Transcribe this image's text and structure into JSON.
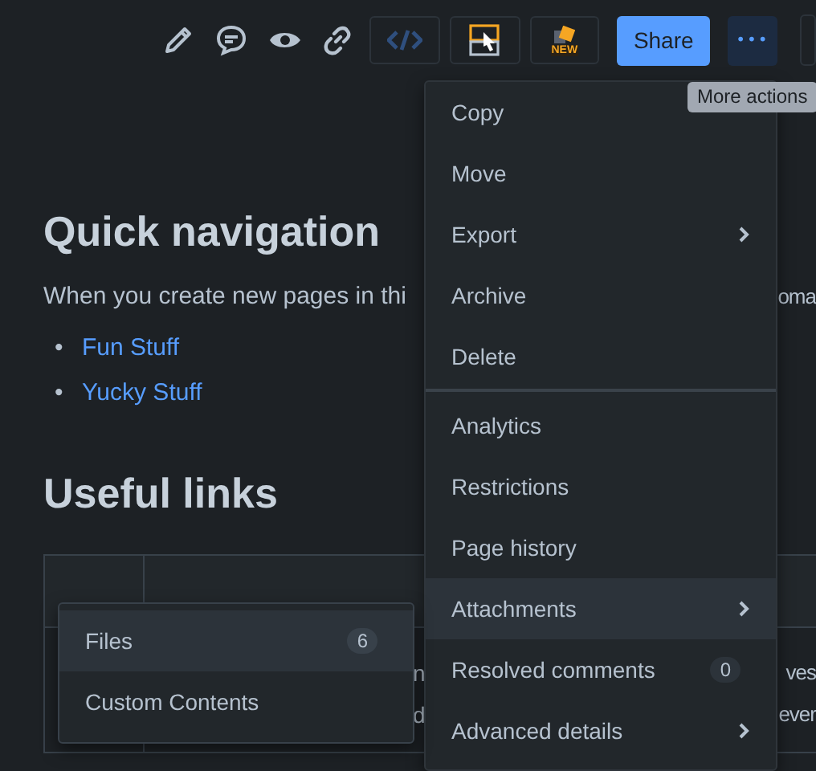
{
  "toolbar": {
    "icons": [
      {
        "kind": "edit"
      },
      {
        "kind": "comment"
      },
      {
        "kind": "watch"
      },
      {
        "kind": "link"
      }
    ],
    "tools": [
      {
        "kind": "code"
      },
      {
        "kind": "macro"
      },
      {
        "kind": "new",
        "label": "NEW"
      }
    ],
    "share": "Share",
    "more": {
      "label": "•••",
      "selected": true
    }
  },
  "tooltip": "More actions",
  "content": {
    "heading_1": "Quick navigation",
    "paragraph": {
      "left": "When you create new pages in thi",
      "right": "oma"
    },
    "links": [
      {
        "marker": "•",
        "label": "Fun Stuff"
      },
      {
        "marker": "•",
        "label": "Yucky Stuff"
      }
    ],
    "heading_2": "Useful links",
    "table": {
      "lines": [
        {
          "left": "n",
          "right": "ves"
        },
        {
          "left": "d",
          "right": "ever"
        }
      ]
    }
  },
  "menu": {
    "sections": [
      {
        "items": [
          {
            "label": "Copy",
            "selected": false,
            "submenu": false
          },
          {
            "label": "Move",
            "selected": false,
            "submenu": false
          },
          {
            "label": "Export",
            "selected": false,
            "submenu": true
          },
          {
            "label": "Archive",
            "selected": false,
            "submenu": false
          },
          {
            "label": "Delete",
            "selected": false,
            "submenu": false
          }
        ]
      },
      {
        "items": [
          {
            "label": "Analytics",
            "selected": false,
            "submenu": false
          },
          {
            "label": "Restrictions",
            "selected": false,
            "submenu": false
          },
          {
            "label": "Page history",
            "selected": false,
            "submenu": false
          },
          {
            "label": "Attachments",
            "selected": true,
            "submenu": true
          },
          {
            "label": "Resolved comments",
            "selected": false,
            "submenu": false,
            "badge": "0"
          },
          {
            "label": "Advanced details",
            "selected": false,
            "submenu": true
          }
        ]
      }
    ]
  },
  "submenu": {
    "items": [
      {
        "label": "Files",
        "selected": true,
        "badge": "6"
      },
      {
        "label": "Custom Contents",
        "selected": false
      }
    ]
  }
}
